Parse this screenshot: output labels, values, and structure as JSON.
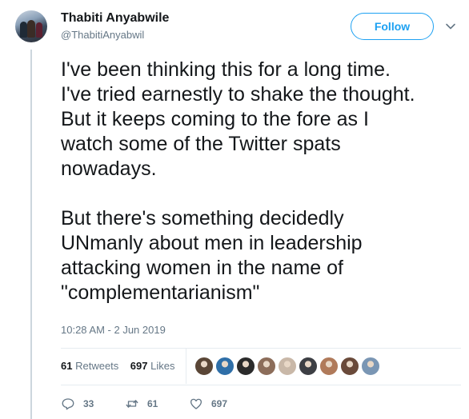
{
  "user": {
    "name": "Thabiti Anyabwile",
    "handle": "@ThabitiAnyabwil"
  },
  "follow_label": "Follow",
  "tweet": {
    "text": "I've been thinking this for a long time.\nI've tried earnestly to shake the thought.\nBut it keeps coming to the fore as I\nwatch some of the Twitter spats\nnowadays.\n\nBut there's something decidedly\nUNmanly about men in leadership\nattacking women in the name of\n\"complementarianism\"",
    "timestamp": "10:28 AM - 2 Jun 2019"
  },
  "stats": {
    "retweets_count": "61",
    "retweets_label": "Retweets",
    "likes_count": "697",
    "likes_label": "Likes"
  },
  "likers": [
    {
      "color": "#5a4636"
    },
    {
      "color": "#2f6fa8"
    },
    {
      "color": "#2b2b2b"
    },
    {
      "color": "#8c6d5a"
    },
    {
      "color": "#c9b8a8"
    },
    {
      "color": "#3d3f44"
    },
    {
      "color": "#b07a5a"
    },
    {
      "color": "#6a4a3a"
    },
    {
      "color": "#7a96b4"
    }
  ],
  "actions": {
    "reply_count": "33",
    "retweet_count": "61",
    "like_count": "697"
  },
  "colors": {
    "accent": "#1da1f2",
    "text": "#14171a",
    "muted": "#657786",
    "divider": "#e6ecf0"
  }
}
